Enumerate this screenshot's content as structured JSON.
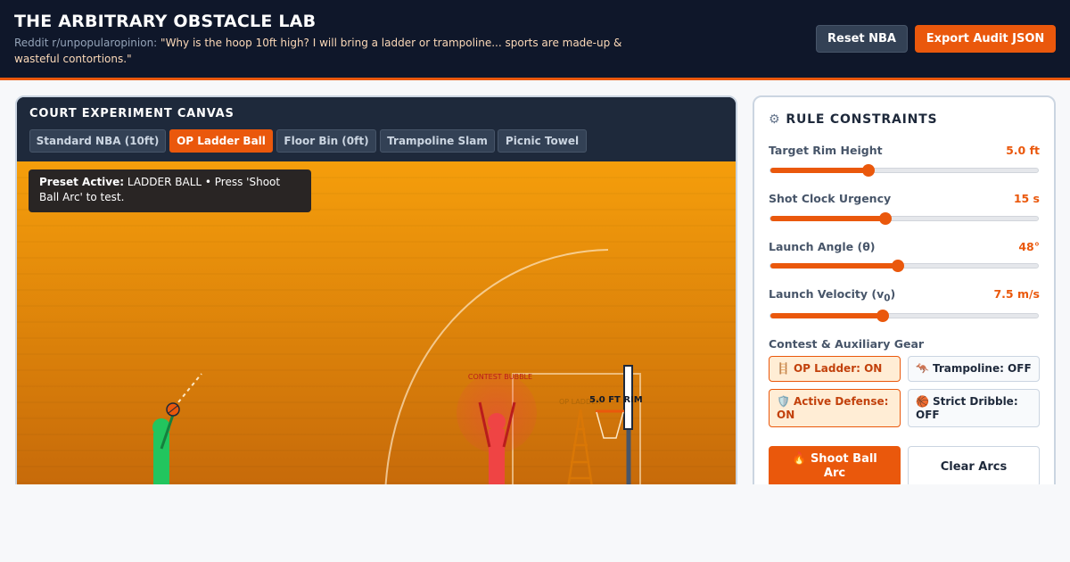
{
  "header": {
    "title": "THE ARBITRARY OBSTACLE LAB",
    "source": "Reddit r/unpopularopinion: ",
    "quote": "\"Why is the hoop 10ft high? I will bring a ladder or trampoline... sports are made-up & wasteful contortions.\"",
    "reset_label": "Reset NBA",
    "export_label": "Export Audit JSON"
  },
  "canvas": {
    "title": "COURT EXPERIMENT CANVAS",
    "presets": [
      {
        "label": "Standard NBA (10ft)",
        "active": false
      },
      {
        "label": "OP Ladder Ball",
        "active": true
      },
      {
        "label": "Floor Bin (0ft)",
        "active": false
      },
      {
        "label": "Trampoline Slam",
        "active": false
      },
      {
        "label": "Picnic Towel",
        "active": false
      }
    ],
    "toast_strong": "Preset Active:",
    "toast_text": " LADDER BALL • Press 'Shoot Ball Arc' to test.",
    "contest_label": "CONTEST BUBBLE",
    "ladder_label": "OP LADDER",
    "rim_label": "5.0 FT RIM"
  },
  "rules": {
    "title": "RULE CONSTRAINTS",
    "sliders": [
      {
        "label": "Target Rim Height",
        "value": "5.0 ft",
        "level": 0.365
      },
      {
        "label": "Shot Clock Urgency",
        "value": "15 s",
        "level": 0.43
      },
      {
        "label": "Launch Angle (θ)",
        "value": "48°",
        "level": 0.475
      },
      {
        "label": "Launch Velocity (v",
        "label_sub": "0",
        "label_end": ")",
        "value": "7.5 m/s",
        "level": 0.42
      }
    ],
    "gear_heading": "Contest & Auxiliary Gear",
    "gear": [
      {
        "icon": "ladder-icon",
        "glyph": "🪜",
        "label": "OP Ladder: ON",
        "on": true
      },
      {
        "icon": "kangaroo-icon",
        "glyph": "🦘",
        "label": "Trampoline: OFF",
        "on": false
      },
      {
        "icon": "shield-icon",
        "glyph": "🛡️",
        "label": "Active Defense: ON",
        "on": true
      },
      {
        "icon": "basketball-icon",
        "glyph": "🏀",
        "label": "Strict Dribble: OFF",
        "on": false
      }
    ],
    "shoot_icon": "fire-icon",
    "shoot_glyph": "🔥",
    "shoot_label": "Shoot Ball Arc",
    "clear_label": "Clear Arcs"
  },
  "colors": {
    "accent": "#ea580c",
    "header_bg": "#0f172a",
    "panel_bg": "#1e293b",
    "shooter": "#22c55e",
    "defender": "#ef4444",
    "court_top": "#f59e0b",
    "court_bottom": "#c2650a"
  }
}
